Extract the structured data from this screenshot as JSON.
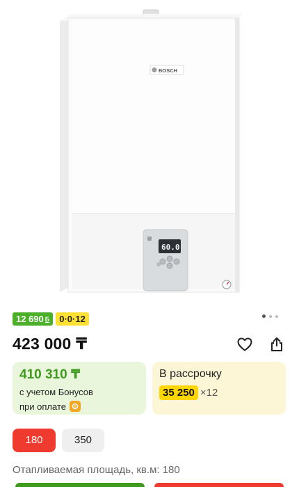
{
  "product": {
    "image_alt": "Газовый котел Bosch",
    "brand_label": "BOSCH",
    "display_value": "60.0"
  },
  "badges": {
    "bonus": "12 690",
    "bonus_currency": "Б",
    "installment": "0·0·12"
  },
  "gallery": {
    "active_index": 0,
    "total": 3
  },
  "price": "423 000 ₸",
  "bonus_card": {
    "price": "410 310 ₸",
    "note1": "с учетом Бонусов",
    "note2": "при оплате"
  },
  "credit_card": {
    "title": "В рассрочку",
    "amount": "35 250",
    "term": "×12"
  },
  "options": {
    "items": [
      "180",
      "350"
    ],
    "selected": "180"
  },
  "area": {
    "label": "Отапливаемая площадь, кв.м: 180"
  },
  "colors": {
    "bonus_green": "#4caf2a",
    "install_yellow": "#ffe033",
    "selected_red": "#ef3b2f"
  }
}
